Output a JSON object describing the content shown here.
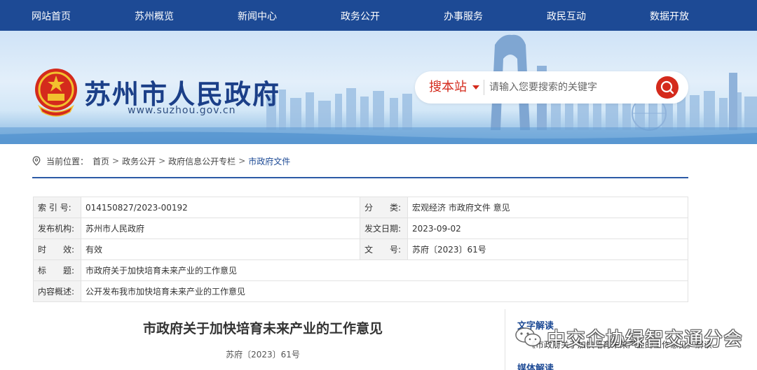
{
  "nav": {
    "items": [
      "网站首页",
      "苏州概览",
      "新闻中心",
      "政务公开",
      "办事服务",
      "政民互动",
      "数据开放"
    ]
  },
  "header": {
    "site_title": "苏州市人民政府",
    "site_url": "www.suzhou.gov.cn",
    "search_scope": "搜本站",
    "search_placeholder": "请输入您要搜索的关键字"
  },
  "breadcrumb": {
    "label": "当前位置：",
    "items": [
      "首页",
      "政务公开",
      "政府信息公开专栏",
      "市政府文件"
    ]
  },
  "info": {
    "index_label": "索 引 号:",
    "index_value": "014150827/2023-00192",
    "category_label": "分　　类:",
    "category_value": "宏观经济 市政府文件 意见",
    "publisher_label": "发布机构:",
    "publisher_value": "苏州市人民政府",
    "date_label": "发文日期:",
    "date_value": "2023-09-02",
    "validity_label": "时　　效:",
    "validity_value": "有效",
    "docno_label": "文　　号:",
    "docno_value": "苏府〔2023〕61号",
    "title_label": "标　　题:",
    "title_value": "市政府关于加快培育未来产业的工作意见",
    "summary_label": "内容概述:",
    "summary_value": "公开发布我市加快培育未来产业的工作意见"
  },
  "article": {
    "title": "市政府关于加快培育未来产业的工作意见",
    "doc_no": "苏府〔2023〕61号"
  },
  "sidebar": {
    "text_interp_heading": "文字解读",
    "text_interp_link": "《市政府关于加快培育未来产业的工作意见》解读",
    "media_heading": "媒体解读"
  },
  "watermark": {
    "text": "中交企协绿智交通分会"
  },
  "colors": {
    "nav_bg": "#1d4a95",
    "accent_red": "#d42a1c",
    "title_blue": "#1b3f88"
  }
}
